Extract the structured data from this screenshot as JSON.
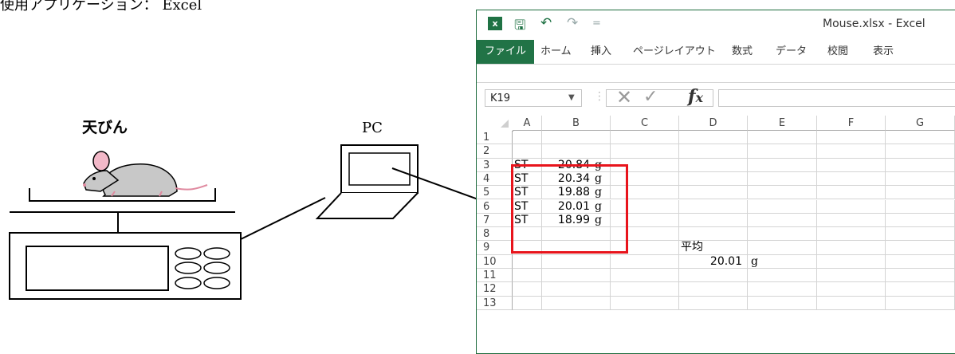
{
  "caption": "使用アプリケーション： Excel",
  "labels": {
    "scale": "天びん",
    "pc": "PC"
  },
  "colors": {
    "excel_green": "#217346",
    "highlight_red": "#e8141c"
  },
  "excel": {
    "window_title": "Mouse.xlsx - Excel",
    "quick_access": [
      "save-icon",
      "undo-icon",
      "redo-icon",
      "customize-icon"
    ],
    "tabs": [
      "ファイル",
      "ホーム",
      "挿入",
      "ページレイアウト",
      "数式",
      "データ",
      "校閲",
      "表示"
    ],
    "name_box": "K19",
    "fx": "fx",
    "columns": [
      "A",
      "B",
      "C",
      "D",
      "E",
      "F",
      "G"
    ],
    "rows": [
      "1",
      "2",
      "3",
      "4",
      "5",
      "6",
      "7",
      "8",
      "9",
      "10",
      "11",
      "12",
      "13"
    ],
    "measurements": [
      {
        "label": "ST",
        "value": "20.84",
        "unit": "g"
      },
      {
        "label": "ST",
        "value": "20.34",
        "unit": "g"
      },
      {
        "label": "ST",
        "value": "19.88",
        "unit": "g"
      },
      {
        "label": "ST",
        "value": "20.01",
        "unit": "g"
      },
      {
        "label": "ST",
        "value": "18.99",
        "unit": "g"
      }
    ],
    "average_label": "平均",
    "average_value": "20.01",
    "average_unit": "g"
  }
}
